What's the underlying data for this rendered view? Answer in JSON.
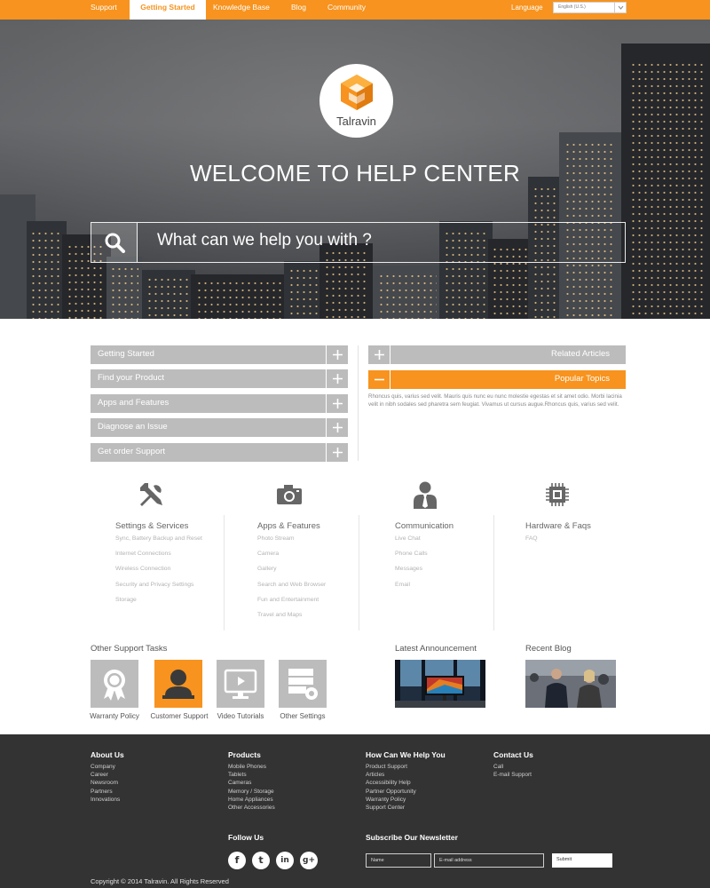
{
  "topnav": {
    "items": [
      "Support",
      "Getting Started",
      "Knowledge Base",
      "Blog",
      "Community"
    ],
    "active": "Getting Started",
    "language_label": "Language",
    "language_value": "English (U.S.)"
  },
  "hero": {
    "logo_text": "Talravin",
    "title": "WELCOME TO HELP CENTER",
    "search_placeholder": "What can we help you with ?"
  },
  "accordion": {
    "items": [
      "Getting Started",
      "Find your Product",
      "Apps and Features",
      "Diagnose an Issue",
      "Get order Support"
    ]
  },
  "tabs": {
    "related": "Related Articles",
    "popular": "Popular Topics",
    "popular_text": "Rhoncus quis, varius sed velit. Mauris quis nunc eu nunc molestie egestas et sit amet odio. Morbi lacinia velit in nibh sodales sed pharetra sem feugiat. Vivamus ut cursus augue.Rhoncus quis, varius sed velit."
  },
  "categories": [
    {
      "icon": "tools-icon",
      "title": "Settings & Services",
      "links": [
        "Sync, Battery Backup and Reset",
        "Internet Connections",
        "Wireless Connection",
        "Security and Privacy Settings",
        "Storage"
      ]
    },
    {
      "icon": "camera-icon",
      "title": "Apps & Features",
      "links": [
        "Photo Stream",
        "Camera",
        "Gallery",
        "Search and Web Browser",
        "Fun and Entertainment",
        "Travel and Maps"
      ]
    },
    {
      "icon": "person-icon",
      "title": "Communication",
      "links": [
        "Live Chat",
        "Phone Calls",
        "Messages",
        "Email"
      ]
    },
    {
      "icon": "chip-icon",
      "title": "Hardware & Faqs",
      "links": [
        "FAQ"
      ]
    }
  ],
  "support_tasks": {
    "heading": "Other Support Tasks",
    "items": [
      {
        "label": "Warranty Policy",
        "icon": "ribbon-icon"
      },
      {
        "label": "Customer Support",
        "icon": "support-agent-icon"
      },
      {
        "label": "Video Tutorials",
        "icon": "video-monitor-icon"
      },
      {
        "label": "Other Settings",
        "icon": "server-settings-icon"
      }
    ]
  },
  "announcement": {
    "heading": "Latest Announcement"
  },
  "blog": {
    "heading": "Recent Blog"
  },
  "footer": {
    "columns": [
      {
        "heading": "About Us",
        "links": [
          "Company",
          "Career",
          "Newsroom",
          "Partners",
          "Innovations"
        ]
      },
      {
        "heading": "Products",
        "links": [
          "Mobile Phones",
          "Tablets",
          "Cameras",
          "Memory / Storage",
          "Home Appliances",
          "Other Accessories"
        ]
      },
      {
        "heading": "How Can We Help You",
        "links": [
          "Product Support",
          "Articles",
          "Accessibility Help",
          "Partner Opportunity",
          "Warranty Policy",
          "Support Center"
        ]
      },
      {
        "heading": "Contact Us",
        "links": [
          "Call",
          "E-mail Support"
        ]
      }
    ],
    "follow_heading": "Follow Us",
    "social": [
      "f",
      "t",
      "in",
      "g+"
    ],
    "newsletter_heading": "Subscribe Our Newsletter",
    "name_placeholder": "Name",
    "email_placeholder": "E-mail address",
    "submit_label": "Submit",
    "copyright": "Copyright © 2014 Talravin. All Rights Reserved"
  },
  "colors": {
    "accent": "#f7931e",
    "gray": "#bcbcbc",
    "footer": "#333333"
  }
}
